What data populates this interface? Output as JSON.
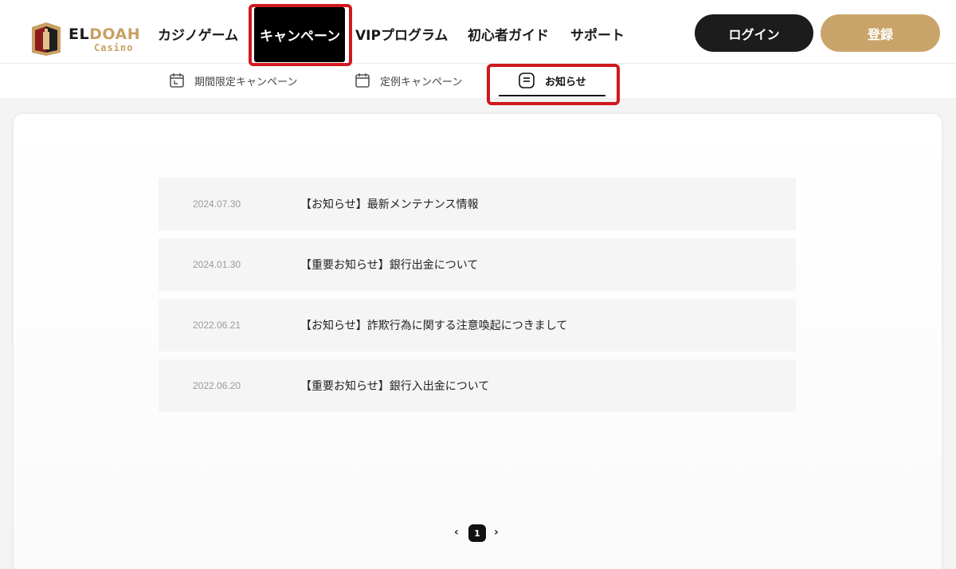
{
  "brand": {
    "logo_main_dark": "EL",
    "logo_main_gold": "DOAH",
    "logo_sub": "Casino",
    "gold_color": "#c9a063"
  },
  "nav": {
    "items": [
      {
        "label": "カジノゲーム"
      },
      {
        "label": "キャンペーン",
        "active": true
      },
      {
        "label": "VIPプログラム"
      },
      {
        "label": "初心者ガイド"
      },
      {
        "label": "サポート"
      }
    ]
  },
  "auth": {
    "login_label": "ログイン",
    "register_label": "登録"
  },
  "subnav": {
    "tabs": [
      {
        "label": "期間限定キャンペーン",
        "icon": "calendar-icon"
      },
      {
        "label": "定例キャンペーン",
        "icon": "calendar-icon"
      },
      {
        "label": "お知らせ",
        "icon": "notice-icon",
        "active": true
      }
    ]
  },
  "notices": [
    {
      "date": "2024.07.30",
      "title": "【お知らせ】最新メンテナンス情報"
    },
    {
      "date": "2024.01.30",
      "title": "【重要お知らせ】銀行出金について"
    },
    {
      "date": "2022.06.21",
      "title": "【お知らせ】詐欺行為に関する注意喚起につきまして"
    },
    {
      "date": "2022.06.20",
      "title": "【重要お知らせ】銀行入出金について"
    }
  ],
  "pagination": {
    "prev": "‹",
    "current": "1",
    "next": "›"
  },
  "colors": {
    "highlight": "#d0181f",
    "login_bg": "#1c1c1c",
    "register_bg": "#c9a46a"
  }
}
